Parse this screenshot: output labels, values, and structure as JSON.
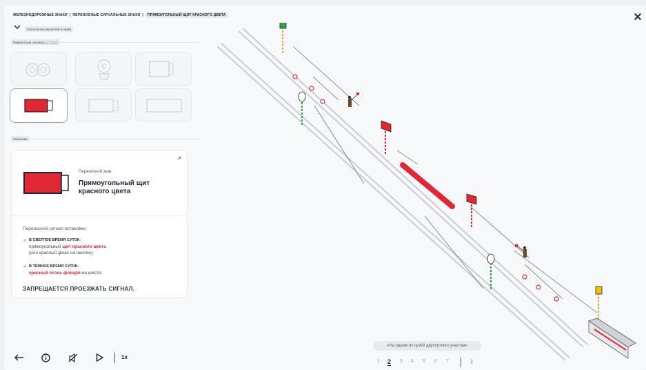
{
  "breadcrumb": {
    "items": [
      "ЖЕЛЕЗНОДОРОЖНЫЕ ЗНАКИ",
      "ПЕРЕНОСНЫЕ СИГНАЛЬНЫЕ ЗНАКИ",
      "ПРЯМОУГОЛЬНЫЙ ЩИТ КРАСНОГО ЦВЕТА"
    ],
    "separator": "|"
  },
  "section_pill": "Сигнальные указатели и знаки",
  "group_pill": "Переносные сигнальные знаки",
  "description_pill": "Описание",
  "sign_tiles": [
    {
      "icon": "disc-signals-icon",
      "selected": false
    },
    {
      "icon": "c-sign-icon",
      "selected": false
    },
    {
      "icon": "rectangle-white-shield-icon",
      "selected": false
    },
    {
      "icon": "rectangle-red-shield-icon",
      "selected": true
    },
    {
      "icon": "rectangle-white-small-shield-icon",
      "selected": false
    },
    {
      "icon": "rectangle-white-wide-shield-icon",
      "selected": false
    }
  ],
  "card": {
    "kind": "Переносной знак",
    "title_line1": "Прямоугольный щит",
    "title_line2": "красного цвета",
    "intro": "Переносной сигнал остановки:",
    "day_heading": "В СВЕТЛОЕ ВРЕМЯ СУТОК:",
    "day_text_prefix": "прямоугольный ",
    "day_text_red": "щит красного цвета",
    "day_text_alt": "(или красный флаг на шесте).",
    "night_heading": "В ТЕМНОЕ ВРЕМЯ СУТОК:",
    "night_text_red": "красный огонь фонаря",
    "night_text_suffix": " на шесте.",
    "warning": "ЗАПРЕЩАЕТСЯ ПРОЕЗЖАТЬ СИГНАЛ."
  },
  "controls": {
    "speed": "1x",
    "icons": [
      "back-arrow-icon",
      "info-icon",
      "sound-off-icon",
      "play-icon"
    ]
  },
  "caption": "«На одном из путей двухпутного участка»",
  "pager": {
    "pages": [
      "1",
      "2",
      "3",
      "4",
      "5",
      "6",
      "7"
    ],
    "current": "2"
  },
  "colors": {
    "signal_red": "#e02733",
    "accent_blue": "#7fa8e0",
    "flag_green": "#2aa84a",
    "flag_yellow": "#f2c200",
    "pole_orange": "#f0a030"
  }
}
